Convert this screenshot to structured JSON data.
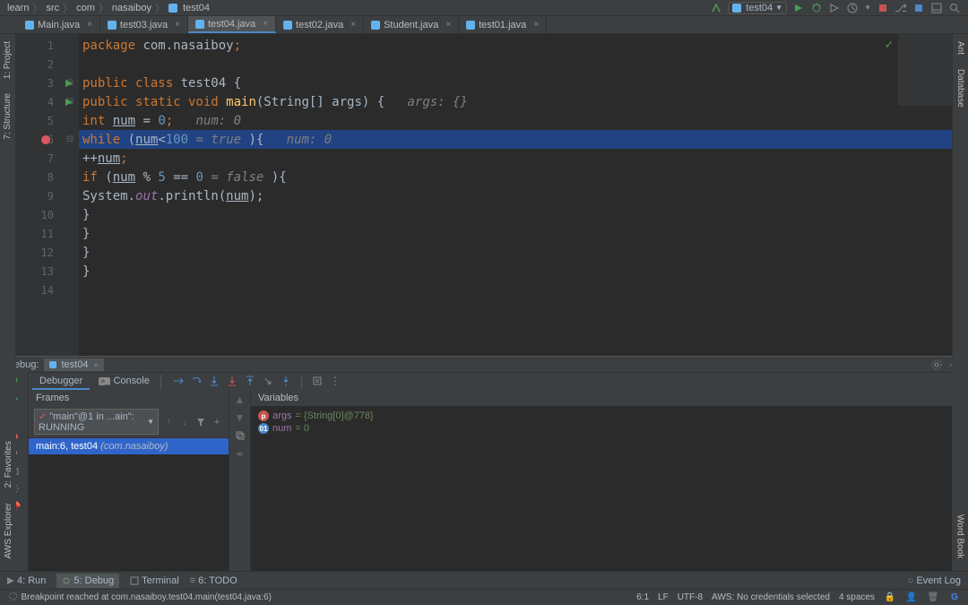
{
  "breadcrumb": {
    "items": [
      "learn",
      "src",
      "com",
      "nasaiboy"
    ],
    "file": "test04"
  },
  "runConfig": "test04",
  "tabs": [
    {
      "label": "Main.java",
      "active": false
    },
    {
      "label": "test03.java",
      "active": false
    },
    {
      "label": "test04.java",
      "active": true
    },
    {
      "label": "test02.java",
      "active": false
    },
    {
      "label": "Student.java",
      "active": false
    },
    {
      "label": "test01.java",
      "active": false
    }
  ],
  "leftTabs": {
    "project": "1: Project",
    "structure": "7: Structure"
  },
  "rightTabs": {
    "ant": "Ant",
    "database": "Database",
    "wordbook": "Word Book"
  },
  "leftBottomTabs": {
    "favorites": "2: Favorites",
    "aws": "AWS Explorer"
  },
  "code": {
    "l1": {
      "pkg": "package",
      "path": " com.nasaiboy",
      "semi": ";"
    },
    "l3": {
      "pub": "public class ",
      "name": "test04 ",
      "brace": "{"
    },
    "l4": {
      "sig1": "public static void ",
      "main": "main",
      "sig2": "(String[] args) {",
      "hint": "   args: {}"
    },
    "l5": {
      "type": "int ",
      "var": "num",
      "rest": " = ",
      "num": "0",
      "semi": ";",
      "hint": "   num: 0"
    },
    "l6": {
      "kw": "while ",
      "open": "(",
      "var": "num",
      "op": "<",
      "num": "100",
      "eval": " = true ",
      "close": ")",
      "brace": "{",
      "hint": "   num: 0"
    },
    "l7": {
      "op": "++",
      "var": "num",
      "semi": ";"
    },
    "l8": {
      "kw": "if ",
      "open": "(",
      "var": "num",
      "op": " % ",
      "n5": "5",
      "eq": " == ",
      "n0": "0",
      "eval": " = false ",
      "close": ")",
      "brace": "{"
    },
    "l9": {
      "sys": "System.",
      "out": "out",
      "dot": ".println(",
      "var": "num",
      "close": ");"
    },
    "l10": "}",
    "l11": "}",
    "l12": "}",
    "l13": "}"
  },
  "debug": {
    "title": "Debug:",
    "tabLabel": "test04",
    "subtabs": {
      "debugger": "Debugger",
      "console": "Console"
    },
    "framesTitle": "Frames",
    "varsTitle": "Variables",
    "thread": "\"main\"@1 in ...ain\": RUNNING",
    "frame": {
      "loc": "main:6, test04",
      "pkg": "(com.nasaiboy)"
    },
    "vars": [
      {
        "icon": "p",
        "name": "args",
        "val": "= {String[0]@778}"
      },
      {
        "icon": "i",
        "name": "num",
        "val": "= 0"
      }
    ]
  },
  "bottomTabs": {
    "run": "4: Run",
    "debug": "5: Debug",
    "terminal": "Terminal",
    "todo": "6: TODO",
    "eventlog": "Event Log"
  },
  "status": {
    "msg": "Breakpoint reached at com.nasaiboy.test04.main(test04.java:6)",
    "pos": "6:1",
    "lf": "LF",
    "enc": "UTF-8",
    "aws": "AWS: No credentials selected",
    "spaces": "4 spaces"
  }
}
